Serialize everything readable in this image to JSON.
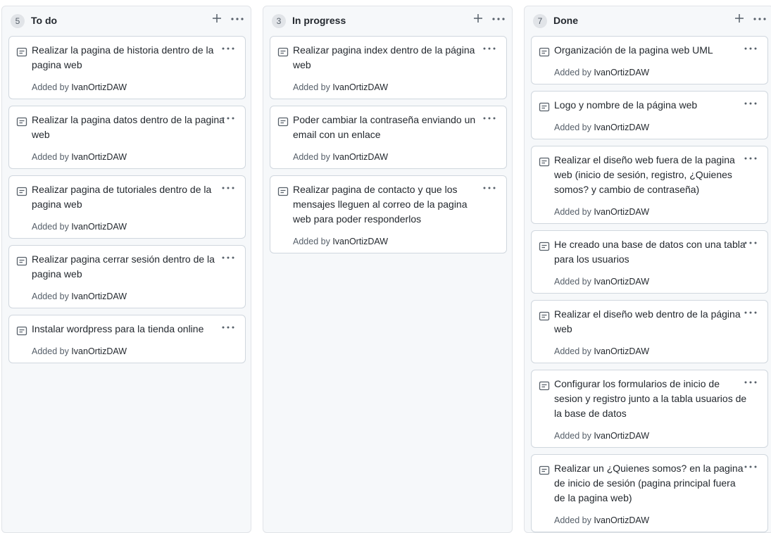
{
  "columns": [
    {
      "count": "5",
      "title": "To do",
      "cards": [
        {
          "title": "Realizar la pagina de historia dentro de la pagina web",
          "added_prefix": "Added by",
          "user": "IvanOrtizDAW"
        },
        {
          "title": "Realizar la pagina datos dentro de la pagina web",
          "added_prefix": "Added by",
          "user": "IvanOrtizDAW"
        },
        {
          "title": "Realizar pagina de tutoriales dentro de la pagina web",
          "added_prefix": "Added by",
          "user": "IvanOrtizDAW"
        },
        {
          "title": "Realizar pagina cerrar sesión dentro de la pagina web",
          "added_prefix": "Added by",
          "user": "IvanOrtizDAW"
        },
        {
          "title": "Instalar wordpress para la tienda online",
          "added_prefix": "Added by",
          "user": "IvanOrtizDAW"
        }
      ]
    },
    {
      "count": "3",
      "title": "In progress",
      "cards": [
        {
          "title": "Realizar pagina index dentro de la página web",
          "added_prefix": "Added by",
          "user": "IvanOrtizDAW"
        },
        {
          "title": "Poder cambiar la contraseña enviando un email con un enlace",
          "added_prefix": "Added by",
          "user": "IvanOrtizDAW"
        },
        {
          "title": "Realizar pagina de contacto y que los mensajes lleguen al correo de la pagina web para poder responderlos",
          "added_prefix": "Added by",
          "user": "IvanOrtizDAW"
        }
      ]
    },
    {
      "count": "7",
      "title": "Done",
      "cards": [
        {
          "title": "Organización de la pagina web UML",
          "added_prefix": "Added by",
          "user": "IvanOrtizDAW"
        },
        {
          "title": "Logo y nombre de la página web",
          "added_prefix": "Added by",
          "user": "IvanOrtizDAW"
        },
        {
          "title": "Realizar el diseño web fuera de la pagina web (inicio de sesión, registro, ¿Quienes somos? y cambio de contraseña)",
          "added_prefix": "Added by",
          "user": "IvanOrtizDAW"
        },
        {
          "title": "He creado una base de datos con una tabla para los usuarios",
          "added_prefix": "Added by",
          "user": "IvanOrtizDAW"
        },
        {
          "title": "Realizar el diseño web dentro de la página web",
          "added_prefix": "Added by",
          "user": "IvanOrtizDAW"
        },
        {
          "title": "Configurar los formularios de inicio de sesion y registro junto a la tabla usuarios de la base de datos",
          "added_prefix": "Added by",
          "user": "IvanOrtizDAW"
        },
        {
          "title": "Realizar un ¿Quienes somos? en la pagina de inicio de sesión (pagina principal fuera de la pagina web)",
          "added_prefix": "Added by",
          "user": "IvanOrtizDAW"
        }
      ]
    }
  ]
}
